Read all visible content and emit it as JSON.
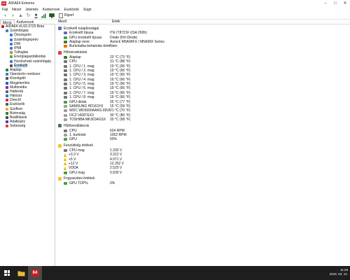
{
  "window": {
    "title": "AIDA64 Extreme",
    "app_badge": "64",
    "minimize_label": "–",
    "maximize_label": "□",
    "close_label": "✕"
  },
  "menu": [
    "Fájl",
    "Nézet",
    "Jelentés",
    "Kedvencek",
    "Eszközök",
    "Súgó"
  ],
  "toolbar": {
    "back_glyph": "‹",
    "forward_glyph": "›",
    "up_glyph": "▲",
    "refresh_glyph": "↻",
    "report_label": "Riport"
  },
  "left_tabs": [
    "Menü",
    "Kedvencek"
  ],
  "tree": [
    {
      "label": "AIDA64 v5.60.3725 Beta",
      "indent": 0,
      "color": "#c81e1e"
    },
    {
      "label": "Számítógép",
      "indent": 1,
      "color": "#3a7bd5"
    },
    {
      "label": "Összegzés",
      "indent": 2,
      "color": "#3a7bd5"
    },
    {
      "label": "Számítógépnév",
      "indent": 2,
      "color": "#3a7bd5"
    },
    {
      "label": "DMI",
      "indent": 2,
      "color": "#3a7bd5"
    },
    {
      "label": "IPMI",
      "indent": 2,
      "color": "#3a7bd5"
    },
    {
      "label": "Túlhajtás",
      "indent": 2,
      "color": "#d9822b"
    },
    {
      "label": "Energiagazdálkodás",
      "indent": 2,
      "color": "#4caf50"
    },
    {
      "label": "Hordozható számítógép",
      "indent": 2,
      "color": "#3a7bd5"
    },
    {
      "label": "Érzékelő",
      "indent": 2,
      "color": "#555555",
      "selected": true
    },
    {
      "label": "Alaplap",
      "indent": 1,
      "color": "#2e7d32"
    },
    {
      "label": "Operációs rendszer",
      "indent": 1,
      "color": "#1e88e5"
    },
    {
      "label": "Kiszolgáló",
      "indent": 1,
      "color": "#6d4c41"
    },
    {
      "label": "Megjelenítés",
      "indent": 1,
      "color": "#1565c0"
    },
    {
      "label": "Multimédia",
      "indent": 1,
      "color": "#8e24aa"
    },
    {
      "label": "Háttértár",
      "indent": 1,
      "color": "#616161"
    },
    {
      "label": "Hálózat",
      "indent": 1,
      "color": "#0288d1"
    },
    {
      "label": "DirectX",
      "indent": 1,
      "color": "#d32f2f"
    },
    {
      "label": "Eszközök",
      "indent": 1,
      "color": "#455a64"
    },
    {
      "label": "Szoftver",
      "indent": 1,
      "color": "#f9a825"
    },
    {
      "label": "Biztonság",
      "indent": 1,
      "color": "#2e7d32"
    },
    {
      "label": "Beállítások",
      "indent": 1,
      "color": "#5d4037"
    },
    {
      "label": "Adatbázis",
      "indent": 1,
      "color": "#3949ab"
    },
    {
      "label": "Sebesség",
      "indent": 1,
      "color": "#e53935"
    }
  ],
  "columns": {
    "field": "Mező",
    "value": "Érték"
  },
  "sections": [
    {
      "title": "Érzékelő tulajdonságai",
      "icon_color": "#5c6bc0",
      "rows": [
        {
          "label": "Érzékelő típusa",
          "value": "ITE IT8721F  (ISA 290h)",
          "icon": "#5c6bc0"
        },
        {
          "label": "GPU érzékelő típusa",
          "value": "Diode  (NV-Diode)",
          "icon": "#43a047"
        },
        {
          "label": "Alaplap neve",
          "value": "Asrock M5A99FX / M5A99X Series",
          "icon": "#2e7d32"
        },
        {
          "label": "Burkolatba behatolás történt",
          "value": "Nem",
          "icon": "#ef6c00"
        }
      ]
    },
    {
      "title": "Hőmérsékletek",
      "icon_color": "#e53935",
      "rows": [
        {
          "label": "Alaplap",
          "value": "23 °C  (73 °F)",
          "icon": "#2e7d32"
        },
        {
          "label": "CPU",
          "value": "31 °C  (88 °F)",
          "icon": "#757575"
        },
        {
          "label": "1. CPU / 1. mag",
          "value": "19 °C  (66 °F)",
          "icon": "#757575"
        },
        {
          "label": "1. CPU / 2. mag",
          "value": "19 °C  (66 °F)",
          "icon": "#757575"
        },
        {
          "label": "1. CPU / 3. mag",
          "value": "19 °C  (66 °F)",
          "icon": "#757575"
        },
        {
          "label": "1. CPU / 4. mag",
          "value": "19 °C  (66 °F)",
          "icon": "#757575"
        },
        {
          "label": "1. CPU / 5. mag",
          "value": "19 °C  (66 °F)",
          "icon": "#757575"
        },
        {
          "label": "1. CPU / 6. mag",
          "value": "19 °C  (66 °F)",
          "icon": "#757575"
        },
        {
          "label": "1. CPU / 7. mag",
          "value": "19 °C  (66 °F)",
          "icon": "#757575"
        },
        {
          "label": "1. CPU / 8. mag",
          "value": "19 °C  (66 °F)",
          "icon": "#757575"
        },
        {
          "label": "GPU dióda",
          "value": "25 °C  (77 °F)",
          "icon": "#43a047"
        },
        {
          "label": "SAMSUNG HD161HJ",
          "value": "15 °C  (59 °F)",
          "icon": "#9e9e9e"
        },
        {
          "label": "WDC WD5000AAKS-00UU3A0",
          "value": "21 °C  (70 °F)",
          "icon": "#9e9e9e"
        },
        {
          "label": "OCZ-VERTEX3",
          "value": "30 °C  (86 °F)",
          "icon": "#9e9e9e"
        },
        {
          "label": "TOSHIBA MK3034GSX",
          "value": "20 °C  (68 °F)",
          "icon": "#9e9e9e"
        }
      ]
    },
    {
      "title": "Hűtőventilátorok",
      "icon_color": "#546e7a",
      "rows": [
        {
          "label": "CPU",
          "value": "624 RPM",
          "icon": "#757575"
        },
        {
          "label": "1. burkolat",
          "value": "1052 RPM",
          "icon": "#9e9e9e"
        },
        {
          "label": "GPU",
          "value": "60%",
          "icon": "#43a047"
        }
      ]
    },
    {
      "title": "Feszültség értékek",
      "icon_color": "#fbc02d",
      "rows": [
        {
          "label": "CPU mag",
          "value": "1.332 V",
          "icon": "#757575"
        },
        {
          "label": "+3.3 V",
          "value": "3.312 V",
          "icon": "warn"
        },
        {
          "label": "+5 V",
          "value": "4.971 V",
          "icon": "warn"
        },
        {
          "label": "+12 V",
          "value": "12.252 V",
          "icon": "warn"
        },
        {
          "label": "VDDA",
          "value": "2.520 V",
          "icon": "warn"
        },
        {
          "label": "GPU mag",
          "value": "0.930 V",
          "icon": "#43a047"
        }
      ]
    },
    {
      "title": "Fogyasztási értékek",
      "icon_color": "#fbc02d",
      "rows": [
        {
          "label": "GPU TDP%",
          "value": "0%",
          "icon": "#43a047"
        }
      ]
    }
  ],
  "taskbar": {
    "app_badge": "64",
    "time": "11:29",
    "date": "2016. 03. 12."
  }
}
